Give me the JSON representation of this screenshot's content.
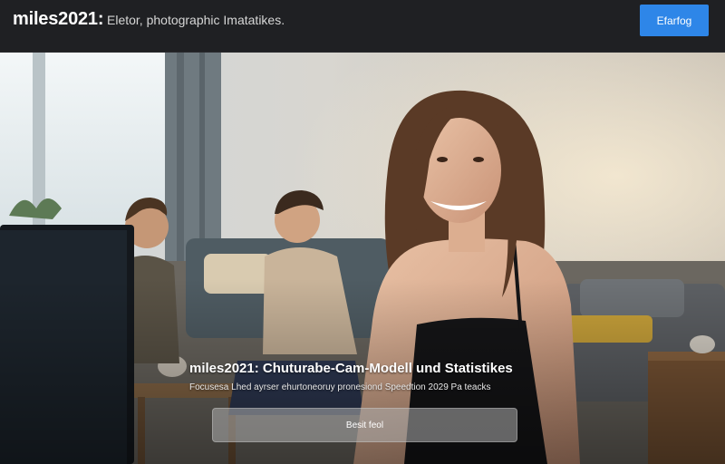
{
  "header": {
    "brand": "miles2021:",
    "tagline": "Eletor, photographic Imatatikes.",
    "button_label": "Efarfog"
  },
  "hero": {
    "image_alt": "woman smiling at computer monitor in living room, two men on sofa behind",
    "headline": "miles2021: Chuturabe-Cam-Modell und Statistikes",
    "subheadline": "Focusesa Lhed ayrser ehurtoneoruy  pronesiond Speedtion 2029 Pa teacks",
    "cta_label": "Besit feol"
  },
  "colors": {
    "accent": "#2e86e8",
    "topbar": "#1f2023"
  }
}
